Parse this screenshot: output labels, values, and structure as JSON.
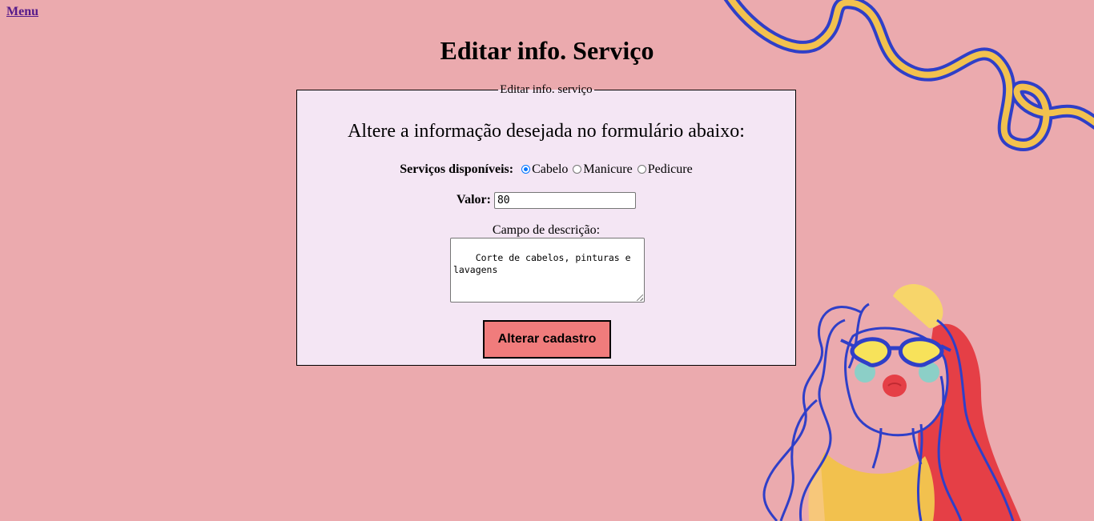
{
  "nav": {
    "menu_label": "Menu"
  },
  "page": {
    "title": "Editar info. Serviço"
  },
  "form": {
    "legend": "Editar info. serviço",
    "instruction": "Altere a informação desejada no formulário abaixo:",
    "services_label": "Serviços disponíveis:",
    "services": [
      {
        "label": "Cabelo",
        "checked": true
      },
      {
        "label": "Manicure",
        "checked": false
      },
      {
        "label": "Pedicure",
        "checked": false
      }
    ],
    "value_label": "Valor:",
    "value": "80",
    "description_label": "Campo de descrição:",
    "description": "Corte de cabelos, pinturas e\nlavagens",
    "submit_label": "Alterar cadastro"
  },
  "colors": {
    "background": "#ebaaae",
    "form_background": "#f4e6f4",
    "button": "#f07c7c",
    "squiggle_yellow": "#f2c14e",
    "squiggle_blue": "#2f3fc8",
    "hair_red": "#e53f46"
  },
  "decorations": {
    "squiggle": "decorative-squiggle-line",
    "illustration": "girl-with-heart-sunglasses-illustration"
  }
}
